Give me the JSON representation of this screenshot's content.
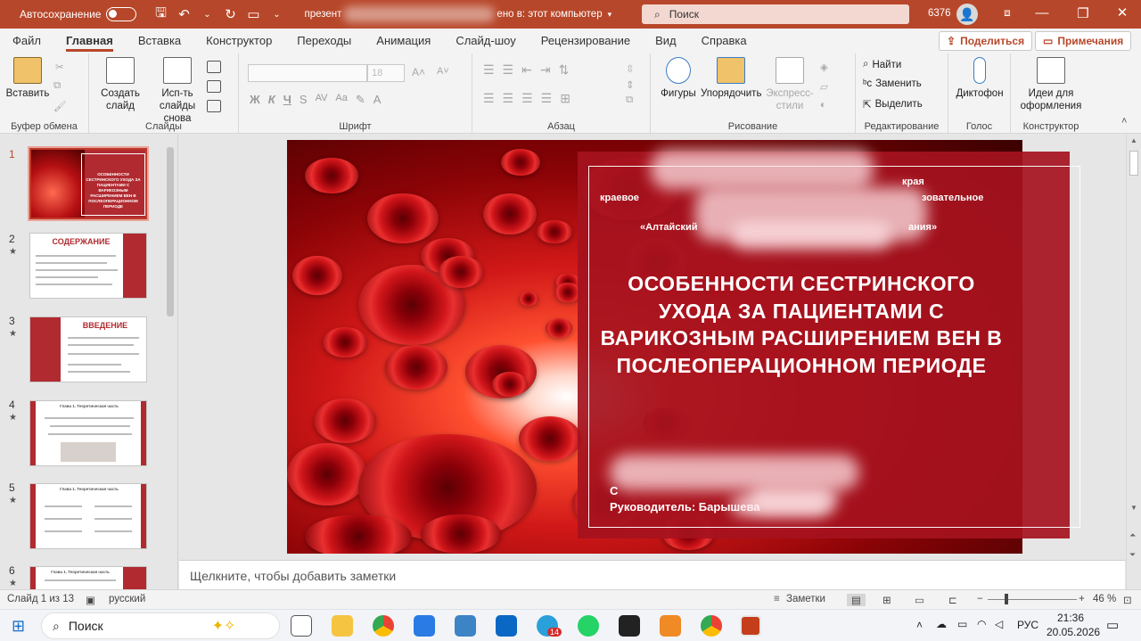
{
  "titlebar": {
    "autosave_label": "Автосохранение",
    "filename": "презент",
    "saved_status": "ено в: этот компьютер",
    "search_placeholder": "Поиск",
    "user_id": "6376"
  },
  "menu": {
    "tabs": [
      "Файл",
      "Главная",
      "Вставка",
      "Конструктор",
      "Переходы",
      "Анимация",
      "Слайд-шоу",
      "Рецензирование",
      "Вид",
      "Справка"
    ],
    "active_tab": "Главная",
    "share": "Поделиться",
    "comments": "Примечания"
  },
  "ribbon": {
    "clipboard": {
      "paste": "Вставить",
      "group": "Буфер обмена"
    },
    "slides": {
      "new_slide": "Создать слайд",
      "reuse": "Исп-ть слайды снова",
      "group": "Слайды"
    },
    "font": {
      "size": "18",
      "group": "Шрифт",
      "bold": "Ж",
      "italic": "К",
      "underline": "Ч",
      "strike": "S",
      "spacing": "AV",
      "case": "Aa"
    },
    "paragraph": {
      "group": "Абзац"
    },
    "drawing": {
      "shapes": "Фигуры",
      "arrange": "Упорядочить",
      "quick_styles": "Экспресс-стили",
      "group": "Рисование"
    },
    "editing": {
      "find": "Найти",
      "replace": "Заменить",
      "select": "Выделить",
      "group": "Редактирование"
    },
    "voice": {
      "dictate": "Диктофон",
      "group": "Голос"
    },
    "designer": {
      "ideas": "Идеи для оформления",
      "group": "Конструктор"
    }
  },
  "thumbnails": [
    {
      "num": "1",
      "title": "ОСОБЕННОСТИ СЕСТРИНСКОГО УХОДА ЗА ПАЦИЕНТАМИ С ВАРИКОЗНЫМ РАСШИРЕНИЕМ ВЕН В ПОСЛЕОПЕРАЦИОННОМ ПЕРИОДЕ",
      "star": ""
    },
    {
      "num": "2",
      "title": "СОДЕРЖАНИЕ",
      "star": "★"
    },
    {
      "num": "3",
      "title": "ВВЕДЕНИЕ",
      "star": "★"
    },
    {
      "num": "4",
      "title": "Глава 1. Теоретическая часть",
      "star": "★"
    },
    {
      "num": "5",
      "title": "Глава 1. Теоретическая часть",
      "star": "★"
    },
    {
      "num": "6",
      "title": "Глава 1. Теоретическая часть",
      "star": "★"
    }
  ],
  "slide": {
    "org_line1": "края",
    "org_line2_left": "краевое",
    "org_line2_right": "зовательное",
    "org_line3_left": "«Алтайский",
    "org_line3_right": "ания»",
    "title": "ОСОБЕННОСТИ СЕСТРИНСКОГО УХОДА ЗА ПАЦИЕНТАМИ С ВАРИКОЗНЫМ РАСШИРЕНИЕМ ВЕН В ПОСЛЕОПЕРАЦИОННОМ ПЕРИОДЕ",
    "author_line1": "С",
    "author_line2": "Руководитель: Барышева"
  },
  "notes_placeholder": "Щелкните, чтобы добавить заметки",
  "status": {
    "slide_counter": "Слайд 1 из 13",
    "language": "русский",
    "notes_btn": "Заметки",
    "zoom": "46 %"
  },
  "taskbar": {
    "search": "Поиск",
    "lang": "РУС",
    "time": "21:36",
    "date": "20.05.2026",
    "telegram_badge": "14"
  },
  "colors": {
    "accent": "#b7472a",
    "slide_red": "#a5121e"
  }
}
